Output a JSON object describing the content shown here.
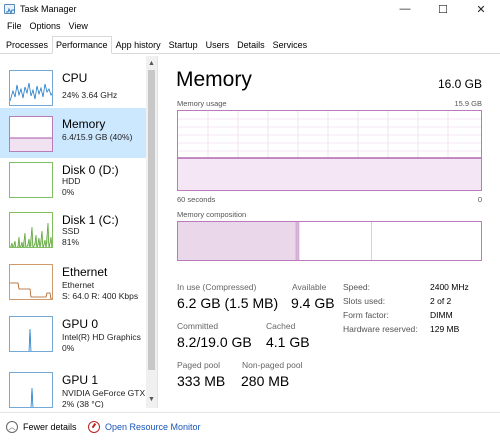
{
  "window": {
    "title": "Task Manager",
    "controls": {
      "minimize": "—",
      "maximize": "☐",
      "close": "✕"
    }
  },
  "menu": [
    "File",
    "Options",
    "View"
  ],
  "tabs": [
    "Processes",
    "Performance",
    "App history",
    "Startup",
    "Users",
    "Details",
    "Services"
  ],
  "active_tab": "Performance",
  "sidebar": {
    "items": [
      {
        "title": "CPU",
        "lines": [
          "24%  3.64 GHz"
        ],
        "color": "#1f7ac7"
      },
      {
        "title": "Memory",
        "lines": [
          "6.4/15.9 GB (40%)"
        ],
        "color": "#8b228b"
      },
      {
        "title": "Disk 0 (D:)",
        "lines": [
          "HDD",
          "0%"
        ],
        "color": "#4d9b26"
      },
      {
        "title": "Disk 1 (C:)",
        "lines": [
          "SSD",
          "81%"
        ],
        "color": "#4d9b26"
      },
      {
        "title": "Ethernet",
        "lines": [
          "Ethernet",
          "S: 64.0  R: 400 Kbps"
        ],
        "color": "#a7581b"
      },
      {
        "title": "GPU 0",
        "lines": [
          "Intel(R) HD Graphics",
          "0%"
        ],
        "color": "#1f7ac7"
      },
      {
        "title": "GPU 1",
        "lines": [
          "NVIDIA GeForce GTX",
          "2%  (38 °C)"
        ],
        "color": "#1f7ac7"
      }
    ],
    "selected": 1
  },
  "memory": {
    "title": "Memory",
    "total": "16.0 GB",
    "usage_label": "Memory usage",
    "usage_max": "15.9 GB",
    "x_left": "60 seconds",
    "x_right": "0",
    "usage_fraction": 0.4,
    "composition_label": "Memory composition",
    "composition_fractions": {
      "in_use": 0.39,
      "modified": 0.01,
      "standby": 0.24,
      "free": 0.36
    },
    "stats": {
      "in_use_label": "In use (Compressed)",
      "in_use_value": "6.2 GB (1.5 MB)",
      "available_label": "Available",
      "available_value": "9.4 GB",
      "committed_label": "Committed",
      "committed_value": "8.2/19.0 GB",
      "cached_label": "Cached",
      "cached_value": "4.1 GB",
      "paged_label": "Paged pool",
      "paged_value": "333 MB",
      "nonpaged_label": "Non-paged pool",
      "nonpaged_value": "280 MB"
    },
    "details": [
      {
        "key": "Speed:",
        "value": "2400 MHz"
      },
      {
        "key": "Slots used:",
        "value": "2 of 2"
      },
      {
        "key": "Form factor:",
        "value": "DIMM"
      },
      {
        "key": "Hardware reserved:",
        "value": "129 MB"
      }
    ]
  },
  "footer": {
    "fewer_details": "Fewer details",
    "open_resmon": "Open Resource Monitor"
  },
  "colors": {
    "memory_accent": "#8b228b",
    "selection": "#cce8ff",
    "link": "#1a56b8"
  }
}
